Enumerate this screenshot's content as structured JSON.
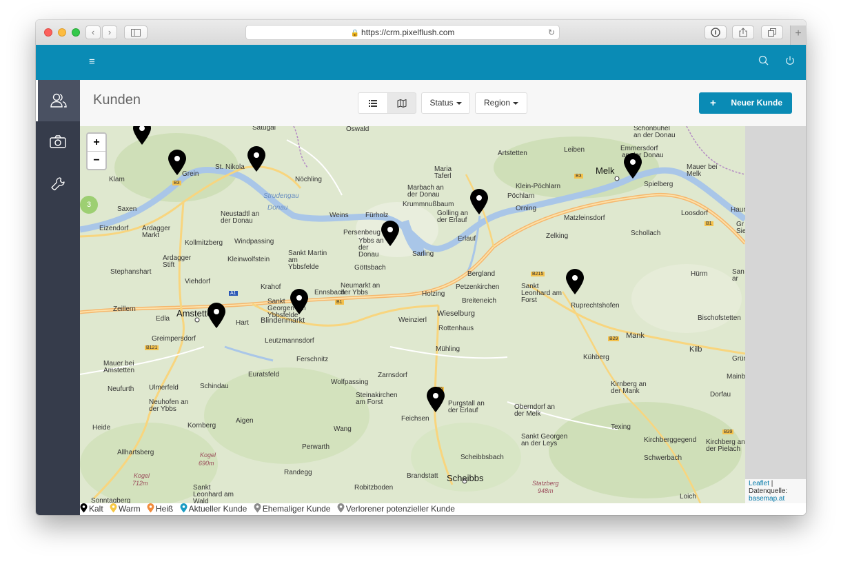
{
  "browser": {
    "url": "https://crm.pixelflush.com"
  },
  "app": {
    "page_title": "Kunden",
    "toolbar": {
      "status_label": "Status",
      "region_label": "Region",
      "new_customer_label": "Neuer Kunde"
    }
  },
  "map": {
    "zoom_in": "+",
    "zoom_out": "−",
    "cluster_count": "3",
    "attribution": {
      "leaflet": "Leaflet",
      "separator": " | Datenquelle: ",
      "source": "basemap.at"
    },
    "labels": {
      "satugal": "Satugal",
      "oswald": "Oswald",
      "schonbuhel": "Schönbühel",
      "an_der_donau": "an der Donau",
      "klam": "Klam",
      "grein": "Grein",
      "st_nikola": "St. Nikola",
      "nochling": "Nöchling",
      "artstetten": "Artstetten",
      "leiben": "Leiben",
      "emmersdorf": "Emmersdorf",
      "an_der_donau2": "an der Donau",
      "melk": "Melk",
      "mauer_bei_melk": "Mauer bei Melk",
      "maria_taferl": "Maria Taferl",
      "marbach": "Marbach an der Donau",
      "strudengau": "Strudengau",
      "klein_pochlarn": "Klein-Pöchlarn",
      "spielberg": "Spielberg",
      "krummnussbaum": "Krummnußbaum",
      "pochlarn": "Pöchlarn",
      "orning": "Orning",
      "saxen": "Saxen",
      "neustadtl": "Neustadtl an der Donau",
      "donau": "Donau",
      "weins": "Weins",
      "furholz": "Fürholz",
      "golling": "Golling an der Erlauf",
      "matzleinsdorf": "Matzleinsdorf",
      "loosdorf": "Loosdorf",
      "eizendorf": "Eizendorf",
      "ardagger_markt": "Ardagger Markt",
      "persenbeug": "Persenbeug",
      "ybbs": "Ybbs an der Donau",
      "erlauf": "Erlauf",
      "schollach": "Schollach",
      "zelking": "Zelking",
      "kollmitzberg": "Kollmitzberg",
      "windpassing": "Windpassing",
      "sankt_martin": "Sankt Martin am Ybbsfelde",
      "sarling": "Sarling",
      "ardagger_stift": "Ardagger Stift",
      "kleinwolfstein": "Kleinwolfstein",
      "gottsbach": "Göttsbach",
      "stephanshart": "Stephanshart",
      "bergland": "Bergland",
      "hurm": "Hürm",
      "viehdorf": "Viehdorf",
      "krahof": "Krahof",
      "ennsbach": "Ennsbach",
      "neumarkt": "Neumarkt an der Ybbs",
      "petzenkirchen": "Petzenkirchen",
      "sankt_leonhard_forst": "Sankt Leonhard am Forst",
      "holzing": "Holzing",
      "breiteneich": "Breiteneich",
      "zeillern": "Zeillern",
      "sankt_georgen_ybbsfelde": "Sankt Georgen am Ybbsfelde",
      "ruprechtshofen": "Ruprechtshofen",
      "amstetten": "Amstetten",
      "edla": "Edla",
      "hart": "Hart",
      "blindenmarkt": "Blindenmarkt",
      "wieselburg": "Wieselburg",
      "weinzierl": "Weinzierl",
      "bischofstetten": "Bischofstetten",
      "rottenhaus": "Rottenhaus",
      "greimpersdorf": "Greimpersdorf",
      "leutzmannsdorf": "Leutzmannsdorf",
      "mank": "Mank",
      "muhling": "Mühling",
      "kilb": "Kilb",
      "mauer_bei_amstetten": "Mauer bei Amstetten",
      "ferschnitz": "Ferschnitz",
      "kuhberg": "Kühberg",
      "euratsfeld": "Euratsfeld",
      "zarnsdorf": "Zarnsdorf",
      "wolfpassing": "Wolfpassing",
      "neufurth": "Neufurth",
      "ulmerfeld": "Ulmerfeld",
      "schindau": "Schindau",
      "kirnberg": "Kirnberg an der Mank",
      "steinakirchen": "Steinakirchen am Forst",
      "purgstall": "Purgstall an der Erlauf",
      "neuhofen": "Neuhofen an der Ybbs",
      "oberndorf": "Oberndorf an der Melk",
      "feichsen": "Feichsen",
      "heide": "Heide",
      "kornberg": "Kornberg",
      "aigen": "Aigen",
      "wang": "Wang",
      "texing": "Texing",
      "sankt_georgen_leys": "Sankt Georgen an der Leys",
      "kirchberggegend": "Kirchberggegend",
      "kirchberg_pielach": "Kirchberg an der Pielach",
      "allhartsberg": "Allhartsberg",
      "perwarth": "Perwarth",
      "scheibbsbach": "Scheibbsbach",
      "schwerbach": "Schwerbach",
      "kogel": "Kogel",
      "kogel_elev": "690m",
      "randegg": "Randegg",
      "brandstatt": "Brandstatt",
      "scheibbs": "Scheibbs",
      "kogel2": "Kogel",
      "kogel2_elev": "712m",
      "robitzboden": "Robitzboden",
      "statzberg": "Statzberg",
      "statzberg_elev": "948m",
      "sankt_leonhard_wald": "Sankt Leonhard am Wald",
      "sonntagberg": "Sonntagberg",
      "loich": "Loich",
      "dorfau": "Dorfau",
      "grun": "Grün",
      "mainb": "Mainb",
      "haun": "Haun",
      "gr_sie": "Gr Sie",
      "san_ar": "San ar",
      "b3": "B3",
      "b3b": "B3",
      "b1": "B1",
      "b1b": "B1",
      "a1": "A1",
      "b215": "B215",
      "b29": "B29",
      "b25": "B25",
      "b121": "B121",
      "b39": "B39"
    }
  },
  "legend": [
    {
      "label": "Kalt",
      "color": "#000000"
    },
    {
      "label": "Warm",
      "color": "#f7c843"
    },
    {
      "label": "Heiß",
      "color": "#f28b3a"
    },
    {
      "label": "Aktueller Kunde",
      "color": "#1a9cc3"
    },
    {
      "label": "Ehemaliger Kunde",
      "color": "#8a8a8a"
    },
    {
      "label": "Verlorener potenzieller Kunde",
      "color": "#8a8a8a"
    }
  ],
  "colors": {
    "brand": "#0a8bb5",
    "sidebar": "#363c4b"
  }
}
